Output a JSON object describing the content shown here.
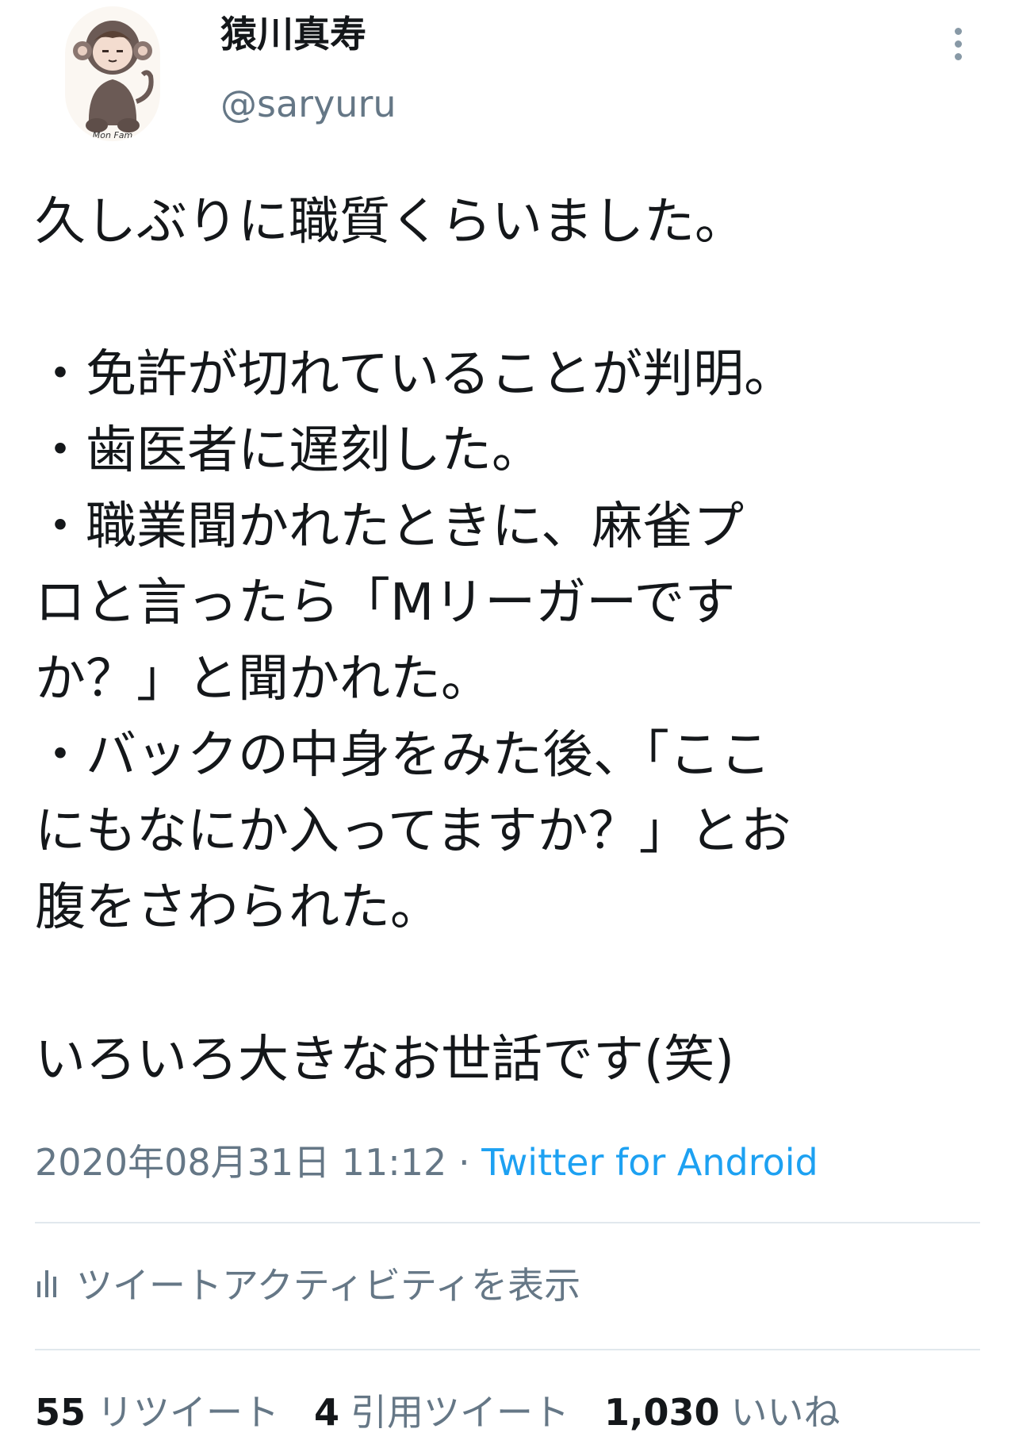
{
  "user": {
    "display_name": "猿川真寿",
    "username": "@saryuru",
    "avatar_text": "Mon Fam"
  },
  "tweet": {
    "lines": [
      "久しぶりに職質くらいました。",
      "",
      "・免許が切れていることが判明。",
      "・歯医者に遅刻した。",
      "・職業聞かれたときに、麻雀プ",
      "ロと言ったら「Mリーガーです",
      "か？」と聞かれた。",
      "・バックの中身をみた後、「ここ",
      "にもなにか入ってますか？」とお",
      "腹をさわられた。",
      "",
      "いろいろ大きなお世話です(笑)"
    ],
    "timestamp": "2020年08月31日 11:12",
    "separator": " · ",
    "source": "Twitter for Android"
  },
  "activity": {
    "label": "ツイートアクティビティを表示",
    "icon": "bar-chart-icon"
  },
  "stats": {
    "retweets": {
      "count": "55",
      "label": "リツイート"
    },
    "quotes": {
      "count": "4",
      "label": "引用ツイート"
    },
    "likes": {
      "count": "1,030",
      "label": "いいね"
    }
  },
  "colors": {
    "text": "#14171a",
    "secondary": "#657786",
    "link": "#1da1f2",
    "divider": "#e1e8ed"
  }
}
